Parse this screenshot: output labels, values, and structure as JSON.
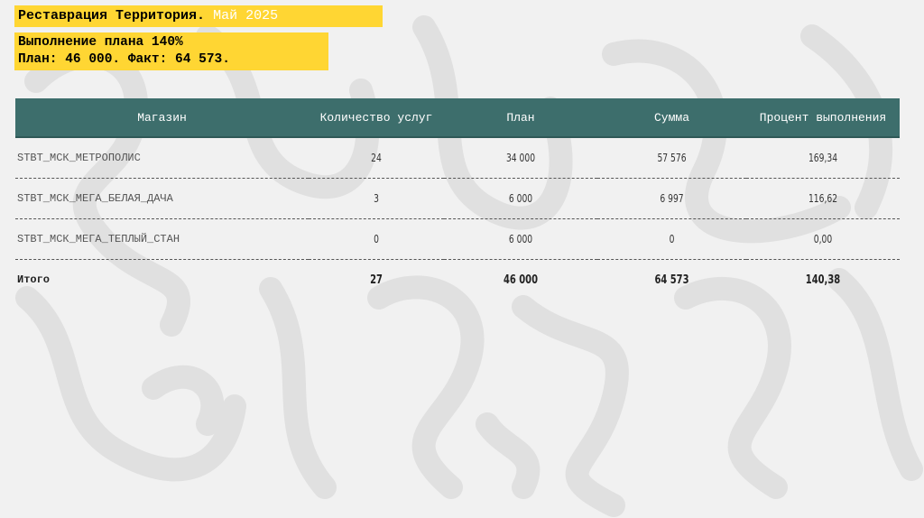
{
  "header": {
    "title": "Реставрация Территория.",
    "month": "Май 2025",
    "plan_line": "Выполнение плана 140%",
    "fact_line": "План: 46 000. Факт: 64 573."
  },
  "table": {
    "columns": [
      "Магазин",
      "Количество услуг",
      "План",
      "Сумма",
      "Процент выполнения"
    ],
    "rows": [
      {
        "store": "STBT_МСК_МЕТРОПОЛИС",
        "services": "24",
        "plan": "34 000",
        "sum": "57 576",
        "percent": "169,34"
      },
      {
        "store": "STBT_МСК_МЕГА_БЕЛАЯ_ДАЧА",
        "services": "3",
        "plan": "6 000",
        "sum": "6 997",
        "percent": "116,62"
      },
      {
        "store": "STBT_МСК_МЕГА_ТЕПЛЫЙ_СТАН",
        "services": "0",
        "plan": "6 000",
        "sum": "0",
        "percent": "0,00"
      }
    ],
    "total": {
      "store": "Итого",
      "services": "27",
      "plan": "46 000",
      "sum": "64 573",
      "percent": "140,38"
    }
  },
  "colors": {
    "accent_yellow": "#ffd633",
    "header_teal": "#3d6e6c",
    "background": "#f1f1f1"
  }
}
